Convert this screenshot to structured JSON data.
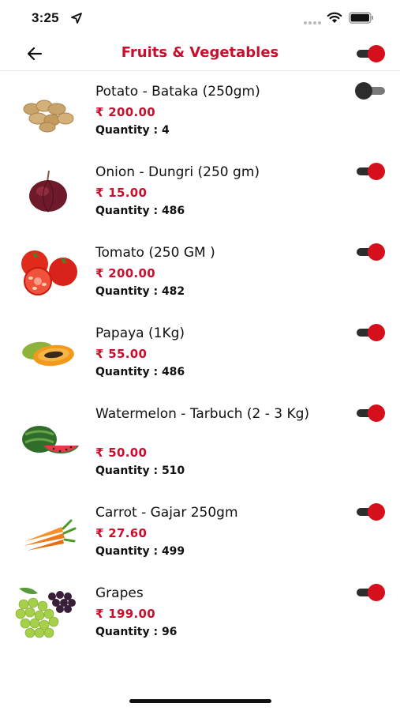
{
  "status_bar": {
    "time": "3:25"
  },
  "header": {
    "title": "Fruits & Vegetables",
    "master_toggle_on": true
  },
  "products": [
    {
      "name": "Potato - Bataka (250gm)",
      "price": "₹ 200.00",
      "quantity": "Quantity : 4",
      "enabled": false
    },
    {
      "name": " Onion - Dungri (250 gm)",
      "price": "₹ 15.00",
      "quantity": "Quantity : 486",
      "enabled": true
    },
    {
      "name": "Tomato (250 GM )",
      "price": "₹ 200.00",
      "quantity": "Quantity : 482",
      "enabled": true
    },
    {
      "name": "Papaya (1Kg)",
      "price": "₹ 55.00",
      "quantity": "Quantity : 486",
      "enabled": true
    },
    {
      "name": " Watermelon - Tarbuch (2 - 3 Kg)",
      "price": "₹ 50.00",
      "quantity": "Quantity : 510",
      "enabled": true
    },
    {
      "name": " Carrot - Gajar 250gm",
      "price": "₹ 27.60",
      "quantity": "Quantity : 499",
      "enabled": true
    },
    {
      "name": "Grapes",
      "price": "₹ 199.00",
      "quantity": "Quantity : 96",
      "enabled": true
    }
  ],
  "colors": {
    "accent": "#c8102e",
    "toggle_on": "#d5101c",
    "toggle_track": "#2d2d2d"
  },
  "icons": [
    "location-arrow-icon",
    "signal-icon",
    "wifi-icon",
    "battery-icon",
    "back-arrow-icon"
  ]
}
